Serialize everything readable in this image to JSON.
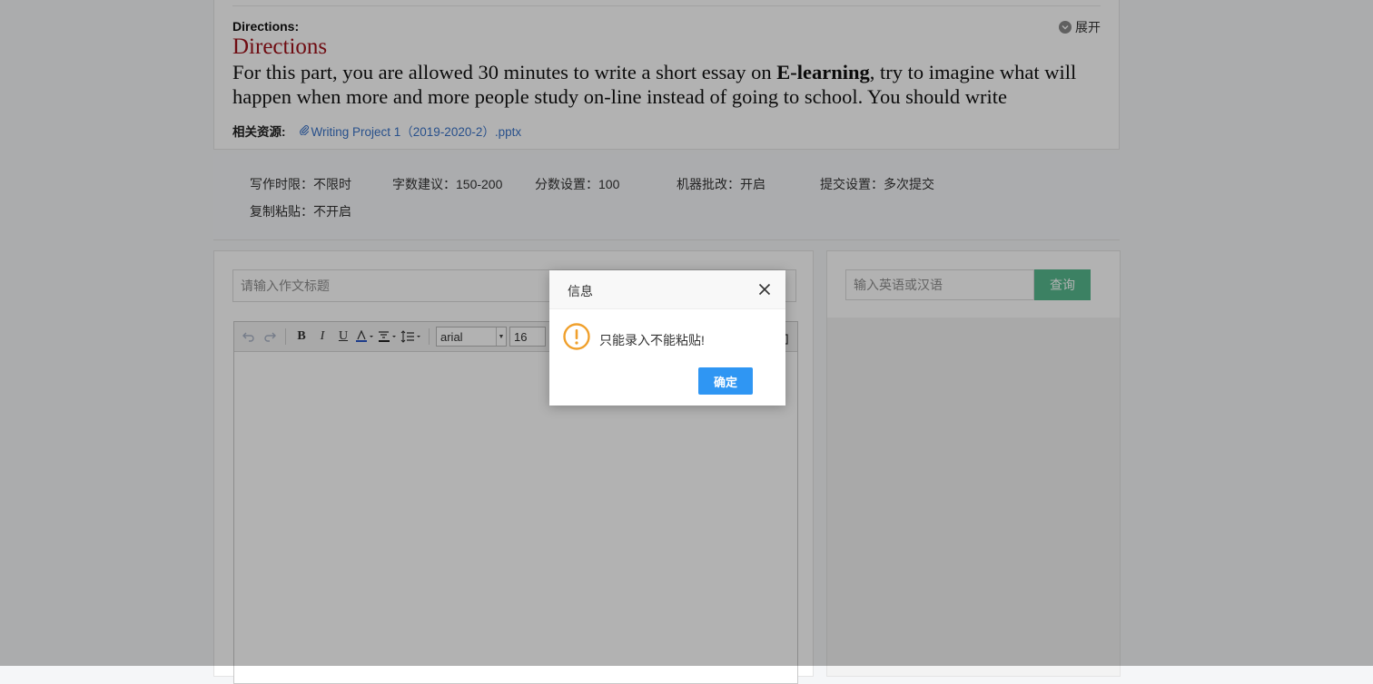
{
  "directions": {
    "label": "Directions:",
    "expand_label": "展开",
    "heading": "Directions",
    "body_before": "For this part, you are allowed 30 minutes to write a short essay on ",
    "body_bold": "E-learning",
    "body_after": ", try to imagine what will happen when more and more people study on-line instead of going to school. You should write",
    "resources_label": "相关资源:",
    "resource_link": "Writing Project 1（2019-2020-2）.pptx"
  },
  "settings": {
    "time_limit": "写作时限：不限时",
    "word_count": "字数建议：150-200",
    "score": "分数设置：100",
    "machine_grading": "机器批改：开启",
    "submission": "提交设置：多次提交",
    "copy_paste": "复制粘贴：不开启"
  },
  "editor": {
    "title_placeholder": "请输入作文标题",
    "toolbar": {
      "bold": "B",
      "italic": "I",
      "underline": "U",
      "font_family": "arial",
      "font_size": "16"
    }
  },
  "dictionary": {
    "placeholder": "输入英语或汉语",
    "search_label": "查询"
  },
  "dialog": {
    "title": "信息",
    "message": "只能录入不能粘贴!",
    "confirm_label": "确定",
    "icon": "warning-icon",
    "icon_color": "#f0a02c"
  },
  "colors": {
    "heading_red": "#a0121a",
    "link_blue": "#3a73c8",
    "search_green": "#57b98e",
    "confirm_blue": "#2f96f3"
  }
}
